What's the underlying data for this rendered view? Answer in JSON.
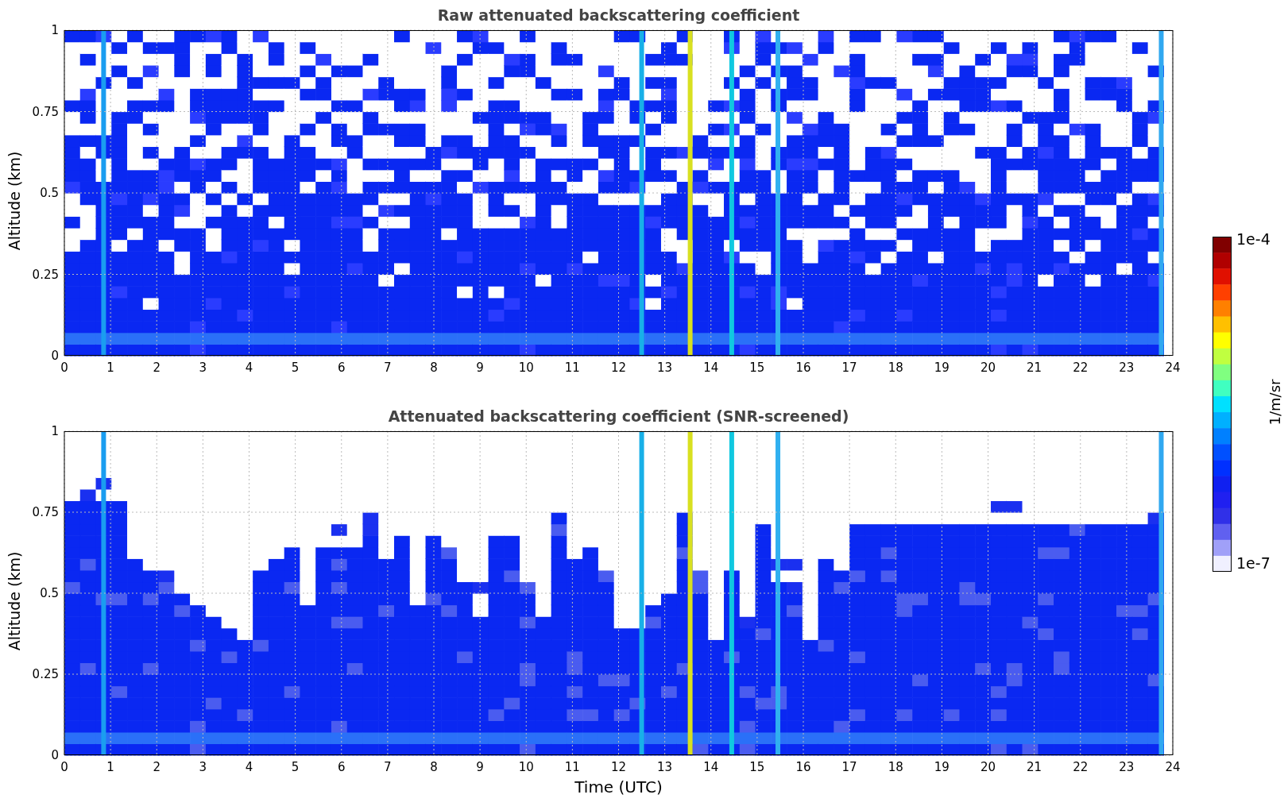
{
  "panels": [
    {
      "kind": "raw",
      "title": "Raw attenuated backscattering coefficient",
      "ylabel": "Altitude (km)",
      "yticks": [
        "1",
        "0.75",
        "0.5",
        "0.25",
        "0"
      ],
      "xticks": [
        "0",
        "1",
        "2",
        "3",
        "4",
        "5",
        "6",
        "7",
        "8",
        "9",
        "10",
        "11",
        "12",
        "13",
        "14",
        "15",
        "16",
        "17",
        "18",
        "19",
        "20",
        "21",
        "22",
        "23",
        "24"
      ]
    },
    {
      "kind": "screened",
      "title": "Attenuated backscattering coefficient (SNR-screened)",
      "ylabel": "Altitude (km)",
      "yticks": [
        "1",
        "0.75",
        "0.5",
        "0.25",
        "0"
      ],
      "xticks": [
        "0",
        "1",
        "2",
        "3",
        "4",
        "5",
        "6",
        "7",
        "8",
        "9",
        "10",
        "11",
        "12",
        "13",
        "14",
        "15",
        "16",
        "17",
        "18",
        "19",
        "20",
        "21",
        "22",
        "23",
        "24"
      ]
    }
  ],
  "xlabel": "Time (UTC)",
  "colorbar": {
    "label": "1/m/sr",
    "max_label": "1e-4",
    "min_label": "1e-7"
  }
}
